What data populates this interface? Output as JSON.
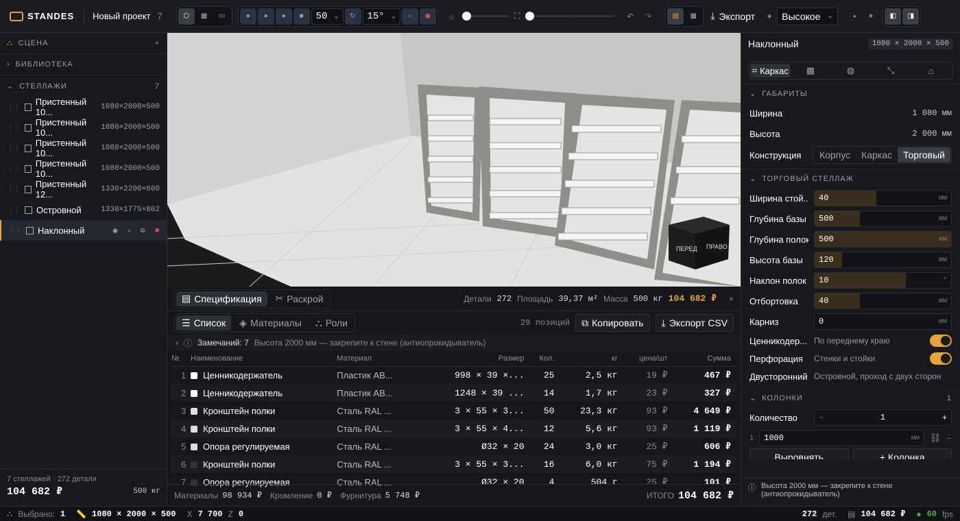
{
  "app": {
    "name": "STANDES",
    "project": "Новый проект",
    "project_count": "7"
  },
  "toolbar": {
    "grid_value": "50",
    "angle_value": "15°",
    "export_label": "Экспорт",
    "quality": "Высокое"
  },
  "sidebar": {
    "scene": "СЦЕНА",
    "library": "БИБЛИОТЕКА",
    "racks": "СТЕЛЛАЖИ",
    "racks_count": "7",
    "items": [
      {
        "name": "Пристенный 10...",
        "size": "1080×2000×500"
      },
      {
        "name": "Пристенный 10...",
        "size": "1080×2000×500"
      },
      {
        "name": "Пристенный 10...",
        "size": "1080×2000×500"
      },
      {
        "name": "Пристенный 10...",
        "size": "1080×2000×500"
      },
      {
        "name": "Пристенный 12...",
        "size": "1330×2200×600"
      },
      {
        "name": "Островной",
        "size": "1330×1775×802"
      },
      {
        "name": "Наклонный",
        "size": ""
      }
    ],
    "footer_summary": "7 стеллажей · 272 детали",
    "footer_total": "104 682 ₽",
    "footer_mass": "500 кг"
  },
  "viewport": {
    "cube_front": "ПЕРЕД",
    "cube_right": "ПРАВО"
  },
  "spec": {
    "tab_spec": "Спецификация",
    "tab_cut": "Раскрой",
    "details_label": "Детали",
    "details": "272",
    "area_label": "Площадь",
    "area": "39,37 м²",
    "mass_label": "Масса",
    "mass": "500 кг",
    "total": "104 682 ₽",
    "sub_list": "Список",
    "sub_materials": "Материалы",
    "sub_roles": "Роли",
    "positions": "29 позиций",
    "copy": "Копировать",
    "export_csv": "Экспорт CSV",
    "notes_label": "Замечаний: 7",
    "notes_text": "Высота 2000 мм — закрепите к стене (антиопрокидыватель)",
    "headers": [
      "№",
      "Наименование",
      "Материал",
      "Размер",
      "Кол.",
      "кг",
      "цена/шт",
      "Сумма"
    ],
    "rows": [
      [
        "1",
        "Ценникодержатель",
        "Пластик АВ...",
        "998 × 39 ×...",
        "25",
        "2,5 кг",
        "19 ₽",
        "467 ₽",
        "#ffffff"
      ],
      [
        "2",
        "Ценникодержатель",
        "Пластик АВ...",
        "1248 × 39 ...",
        "14",
        "1,7 кг",
        "23 ₽",
        "327 ₽",
        "#ffffff"
      ],
      [
        "3",
        "Кронштейн полки",
        "Сталь RAL ...",
        "3 × 55 × 3...",
        "50",
        "23,3 кг",
        "93 ₽",
        "4 649 ₽",
        "#dddddd"
      ],
      [
        "4",
        "Кронштейн полки",
        "Сталь RAL ...",
        "3 × 55 × 4...",
        "12",
        "5,6 кг",
        "93 ₽",
        "1 119 ₽",
        "#dddddd"
      ],
      [
        "5",
        "Опора регулируемая",
        "Сталь RAL ...",
        "Ø32 × 20",
        "24",
        "3,0 кг",
        "25 ₽",
        "606 ₽",
        "#dddddd"
      ],
      [
        "6",
        "Кронштейн полки",
        "Сталь RAL ...",
        "3 × 55 × 3...",
        "16",
        "6,0 кг",
        "75 ₽",
        "1 194 ₽",
        "#333333"
      ],
      [
        "7",
        "Опора регулируемая",
        "Сталь RAL ...",
        "Ø32 × 20",
        "4",
        "504 г",
        "25 ₽",
        "101 ₽",
        "#333333"
      ]
    ],
    "foot_materials_label": "Материалы",
    "foot_materials": "98 934 ₽",
    "foot_edge_label": "Кромление",
    "foot_edge": "0 ₽",
    "foot_hw_label": "Фурнитура",
    "foot_hw": "5 748 ₽",
    "foot_total_label": "ИТОГО",
    "foot_total": "104 682 ₽"
  },
  "props": {
    "title": "Наклонный",
    "dims": "1080 × 2000 × 500",
    "tab_frame": "Каркас",
    "sec_dims": "ГАБАРИТЫ",
    "width_label": "Ширина",
    "width": "1 080 мм",
    "height_label": "Высота",
    "height": "2 000 мм",
    "construction_label": "Конструкция",
    "c1": "Корпус",
    "c2": "Каркас",
    "c3": "Торговый",
    "sec_trade": "ТОРГОВЫЙ СТЕЛЛАЖ",
    "fields": [
      {
        "label": "Ширина стой...",
        "value": "40",
        "unit": "мм",
        "fill": 0.45
      },
      {
        "label": "Глубина базы",
        "value": "500",
        "unit": "мм",
        "fill": 0.33
      },
      {
        "label": "Глубина полок",
        "value": "500",
        "unit": "мм",
        "fill": 1.0
      },
      {
        "label": "Высота базы",
        "value": "120",
        "unit": "мм",
        "fill": 0.2
      },
      {
        "label": "Наклон полок",
        "value": "10",
        "unit": "°",
        "fill": 0.67
      },
      {
        "label": "Отбортовка",
        "value": "40",
        "unit": "мм",
        "fill": 0.33
      },
      {
        "label": "Карниз",
        "value": "0",
        "unit": "мм",
        "fill": 0
      }
    ],
    "price_label": "Ценникодер...",
    "price_val": "По переднему краю",
    "perf_label": "Перфорация",
    "perf_val": "Стенки и стойки",
    "double_label": "Двусторонний",
    "double_val": "Островной, проход с двух сторон",
    "sec_cols": "КОЛОНКИ",
    "cols_count": "1",
    "qty_label": "Количество",
    "qty": "1",
    "col_val": "1000",
    "col_unit": "мм",
    "col_idx": "1",
    "align_btn": "Выровнять",
    "add_col_btn": "+ Колонка",
    "note": "Высота 2000 мм — закрепите к стене (антиопрокидыватель)"
  },
  "status": {
    "selected_label": "Выбрано:",
    "selected": "1",
    "dims": "1080 × 2000 × 500",
    "x_label": "X",
    "x": "7 700",
    "z_label": "Z",
    "z": "0",
    "details": "272",
    "details_unit": "дет.",
    "price": "104 682 ₽",
    "fps": "60",
    "fps_unit": "fps"
  }
}
